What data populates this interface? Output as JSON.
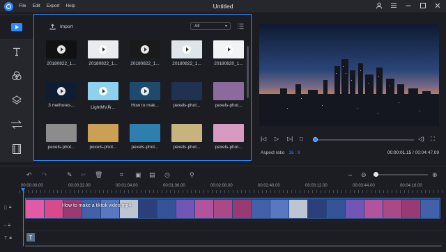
{
  "app": {
    "title": "Untitled",
    "menu": [
      "File",
      "Edit",
      "Export",
      "Help"
    ],
    "window_controls": [
      "user-icon",
      "menu-icon",
      "minimize-icon",
      "maximize-icon",
      "close-icon"
    ]
  },
  "left_tools": [
    {
      "name": "media",
      "icon": "play-icon",
      "active": true
    },
    {
      "name": "text",
      "icon": "text-icon"
    },
    {
      "name": "filters",
      "icon": "filters-icon"
    },
    {
      "name": "overlays",
      "icon": "layers-icon"
    },
    {
      "name": "transitions",
      "icon": "transition-icon"
    },
    {
      "name": "elements",
      "icon": "film-icon"
    }
  ],
  "library": {
    "import_label": "Import",
    "filter_value": "All",
    "items": [
      {
        "caption": "20180822_1...",
        "color": "#111111"
      },
      {
        "caption": "20180822_1...",
        "color": "#e9ecef"
      },
      {
        "caption": "20180822_1...",
        "color": "#1a1a1a"
      },
      {
        "caption": "20180822_1...",
        "color": "#dfe4ea"
      },
      {
        "caption": "20180820_1...",
        "color": "#f1f3f5"
      },
      {
        "caption": "3 melhores...",
        "color": "#0f1d33"
      },
      {
        "caption": "LightMV片...",
        "color": "#8fd0ee"
      },
      {
        "caption": "How to mak...",
        "color": "#1f4a6e"
      },
      {
        "caption": "pexels-phot...",
        "color": "#1f3350"
      },
      {
        "caption": "pexels-phot...",
        "color": "#8a6b9c"
      },
      {
        "caption": "pexels-phot...",
        "color": "#8c8c8c"
      },
      {
        "caption": "pexels-phot...",
        "color": "#c9a054"
      },
      {
        "caption": "pexels-phot...",
        "color": "#2f7fae"
      },
      {
        "caption": "pexels-phot...",
        "color": "#c8b27d"
      },
      {
        "caption": "pexels-phot...",
        "color": "#d79ac1"
      }
    ]
  },
  "preview": {
    "aspect_label": "Aspect ratio",
    "aspect_value": "16 : 9",
    "current_time": "00:00:01.15",
    "total_time": "/ 00:04:47.09",
    "progress": 0.0
  },
  "timeline": {
    "ticks": [
      "00:00:00.00",
      "00:00:32.00",
      "00:01:04.00",
      "00:01:36.00",
      "00:02:08.00",
      "00:02:40.00",
      "00:03:12.00",
      "00:03:44.00",
      "00:04:16.00"
    ],
    "clip_title": "How to make a tiktok video.mp4",
    "text_track_label": "T"
  }
}
